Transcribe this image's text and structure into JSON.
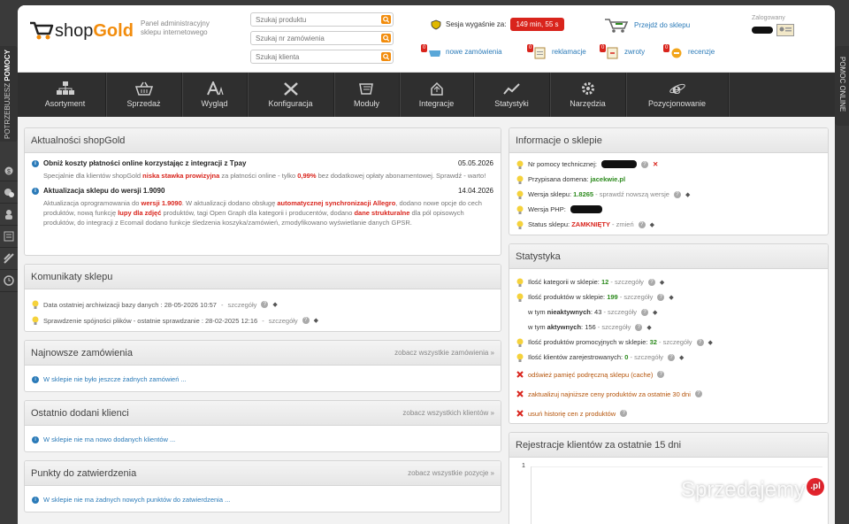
{
  "header": {
    "logo_text_1": "shop",
    "logo_text_2": "Gold",
    "panel_subtitle": "Panel administracyjny sklepu internetowego",
    "search_product": "Szukaj produktu",
    "search_order": "Szukaj nr zamówienia",
    "search_client": "Szukaj klienta",
    "session_label": "Sesja wygaśnie za:",
    "session_time": "149 min, 55 s",
    "go_to_shop": "Przejdź do sklepu",
    "logged_label": "Zalogowany",
    "notifications": [
      {
        "count": "0",
        "label": "nowe zamówienia"
      },
      {
        "count": "0",
        "label": "reklamacje"
      },
      {
        "count": "0",
        "label": "zwroty"
      },
      {
        "count": "0",
        "label": "recenzje"
      }
    ]
  },
  "nav": [
    {
      "label": "Asortyment",
      "icon": "sitemap-icon"
    },
    {
      "label": "Sprzedaż",
      "icon": "basket-icon"
    },
    {
      "label": "Wygląd",
      "icon": "font-icon"
    },
    {
      "label": "Konfiguracja",
      "icon": "tools-icon"
    },
    {
      "label": "Moduły",
      "icon": "modules-icon"
    },
    {
      "label": "Integracje",
      "icon": "integration-icon"
    },
    {
      "label": "Statystyki",
      "icon": "chart-icon"
    },
    {
      "label": "Narzędzia",
      "icon": "gear-icon"
    },
    {
      "label": "Pozycjonowanie",
      "icon": "ie-icon"
    }
  ],
  "side": {
    "help_label_1": "POTRZEBUJESZ ",
    "help_label_2": "POMOCY",
    "online_help": "POMOC ONLINE"
  },
  "news": {
    "title": "Aktualności shopGold",
    "items": [
      {
        "title": "Obniż koszty płatności online korzystając z integracji z Tpay",
        "date": "05.05.2026",
        "text_1": "Specjalnie dla klientów shopGold ",
        "hl_1": "niska stawka prowizyjna",
        "text_2": " za płatności online - tylko ",
        "hl_2": "0,99%",
        "text_3": " bez dodatkowej opłaty abonamentowej. Sprawdź - warto!"
      },
      {
        "title": "Aktualizacja sklepu do wersji 1.9090",
        "date": "14.04.2026",
        "text_1": "Aktualizacja oprogramowania do ",
        "hl_1": "wersji 1.9090",
        "text_2": ". W aktualizacji dodano obsługę ",
        "hl_2": "automatycznej synchronizacji Allegro",
        "text_3": ", dodano nowe opcje do cech produktów, nową funkcję ",
        "hl_3": "lupy dla zdjęć",
        "text_4": " produktów, tagi Open Graph dla kategorii i producentów, dodano ",
        "hl_4": "dane strukturalne",
        "text_5": " dla pól opisowych produktów, do integracji z Ecomail dodano funkcje śledzenia koszyka/zamówień, zmodyfikowano wyświetlanie danych GPSR."
      }
    ]
  },
  "messages": {
    "title": "Komunikaty sklepu",
    "items": [
      {
        "text": "Data ostatniej archiwizacji bazy danych : 28-05-2026 10:57",
        "link": "szczegóły"
      },
      {
        "text": "Sprawdzenie spójności plików - ostatnie sprawdzanie : 28-02-2025 12:16",
        "link": "szczegóły"
      }
    ]
  },
  "orders": {
    "title": "Najnowsze zamówienia",
    "link": "zobacz wszystkie zamówienia",
    "empty": "W sklepie nie było jeszcze żadnych zamówień ..."
  },
  "clients": {
    "title": "Ostatnio dodani klienci",
    "link": "zobacz wszystkich klientów",
    "empty": "W sklepie nie ma nowo dodanych klientów ..."
  },
  "approval": {
    "title": "Punkty do zatwierdzenia",
    "link": "zobacz wszystkie pozycje",
    "empty": "W sklepie nie ma żadnych nowych punktów do zatwierdzenia ..."
  },
  "shop_info": {
    "title": "Informacje o sklepie",
    "help_no": "Nr pomocy technicznej:",
    "domain_label": "Przypisana domena: ",
    "domain": "jacekwie.pl",
    "version_label": "Wersja sklepu: ",
    "version": "1.8265",
    "version_link": "sprawdź nowszą wersje",
    "php_label": "Wersja PHP:",
    "status_label": "Status sklepu: ",
    "status": "ZAMKNIĘTY",
    "status_link": "zmień"
  },
  "stats": {
    "title": "Statystyka",
    "categories_label": "Ilość kategorii w sklepie: ",
    "categories": "12",
    "products_label": "Ilość produktów w sklepie: ",
    "products": "199",
    "inactive_label_1": "w tym ",
    "inactive_label_2": "nieaktywnych",
    "inactive": "43",
    "active_label_1": "w tym ",
    "active_label_2": "aktywnych",
    "active": "156",
    "promo_label": "Ilość produktów promocyjnych w sklepie: ",
    "promo": "32",
    "registered_label": "Ilość klientów zarejestrowanych: ",
    "registered": "0",
    "details": "szczegóły",
    "action_1": "odśwież pamięć podręczną sklepu (cache)",
    "action_2": "zaktualizuj najniższe ceny produktów za ostatnie 30 dni",
    "action_3": "usuń historię cen z produktów"
  },
  "registrations": {
    "title": "Rejestracje klientów za ostatnie 15 dni",
    "y_top": "1"
  },
  "watermark": {
    "text": "Sprzedajemy",
    "badge": ".pl"
  },
  "colors": {
    "accent": "#f28c0c",
    "nav_bg": "#2f2f2f",
    "link": "#2a7ab8",
    "red": "#d9241c",
    "green": "#2e8b1f"
  }
}
